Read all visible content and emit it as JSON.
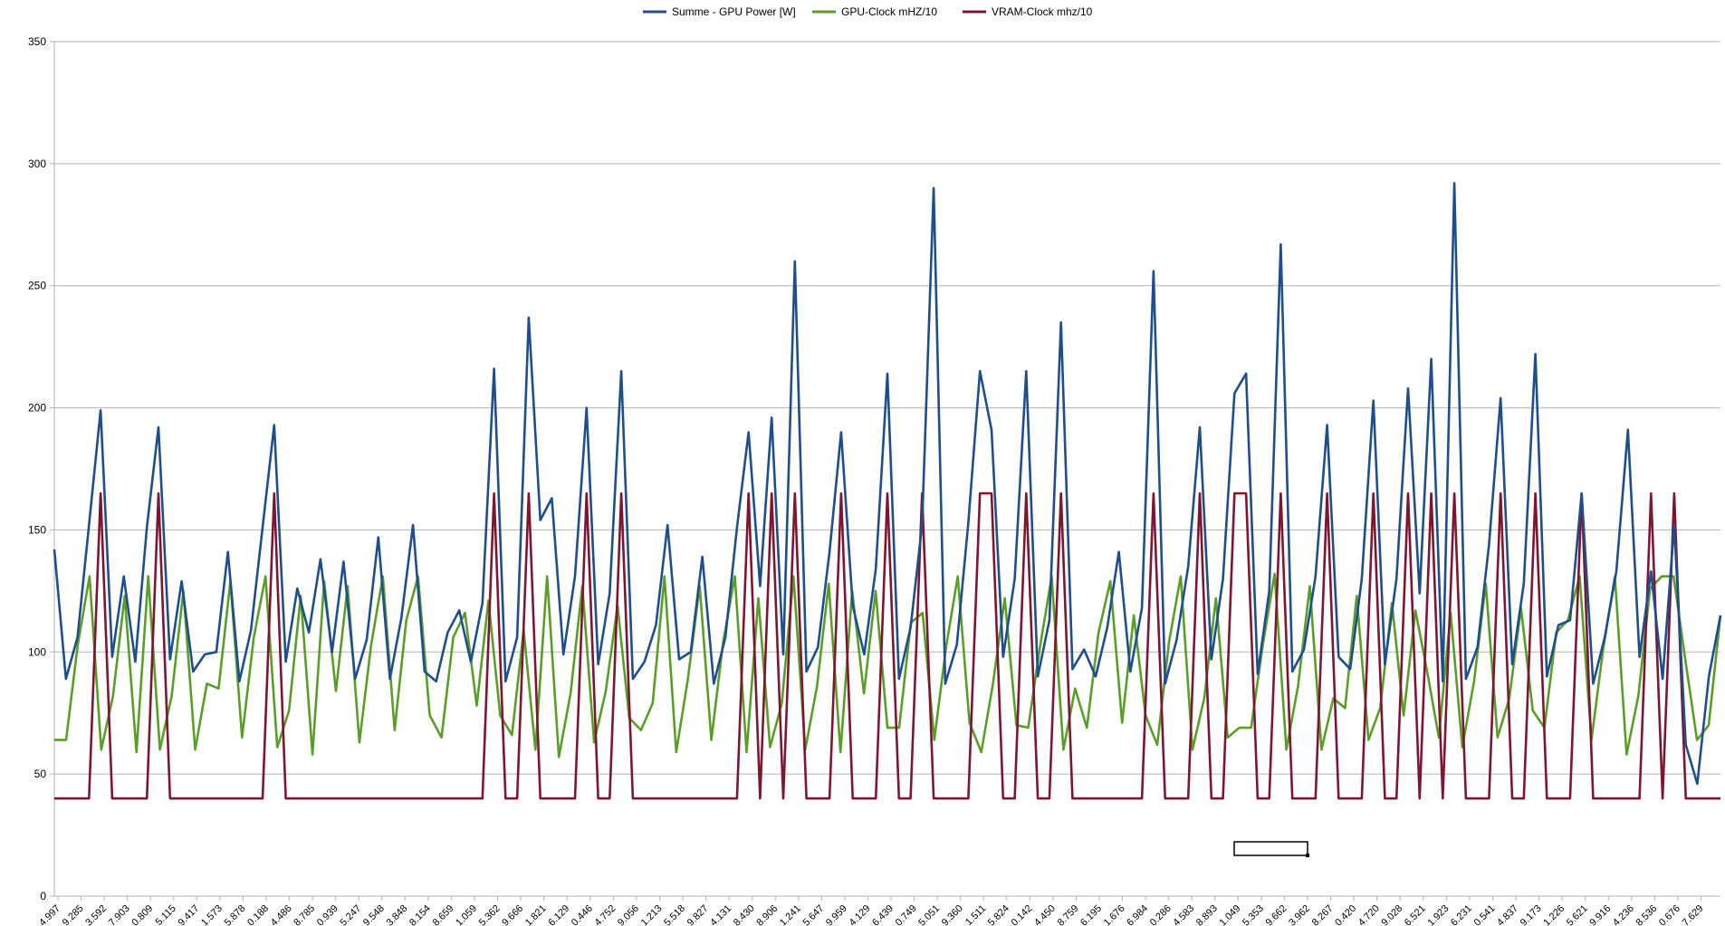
{
  "chart_data": {
    "type": "line",
    "title": "",
    "xlabel": "",
    "ylabel": "",
    "ylim": [
      0,
      350
    ],
    "yticks": [
      0,
      50,
      100,
      150,
      200,
      250,
      300,
      350
    ],
    "grid": "horizontal",
    "legend_position": "top-center",
    "colors": {
      "power": "#1f4e8c",
      "gpu_clock": "#5a9e28",
      "vram_clock": "#7e1632",
      "grid": "#b3b3b3",
      "axis": "#b3b3b3"
    },
    "x_tick_labels": [
      "4.997",
      "9.285",
      "3.592",
      "7.903",
      "0.809",
      "5.115",
      "9.417",
      "1.573",
      "5.878",
      "0.188",
      "4.486",
      "8.785",
      "0.939",
      "5.247",
      "9.548",
      "3.848",
      "8.154",
      "8.659",
      "1.059",
      "5.362",
      "9.666",
      "1.821",
      "6.129",
      "0.446",
      "4.752",
      "9.056",
      "1.213",
      "5.518",
      "9.827",
      "4.131",
      "8.430",
      "8.906",
      "1.241",
      "5.647",
      "9.959",
      "4.129",
      "6.439",
      "0.749",
      "5.051",
      "9.360",
      "1.511",
      "5.824",
      "0.142",
      "4.450",
      "8.759",
      "6.195",
      "1.676",
      "6.984",
      "0.286",
      "4.583",
      "8.893",
      "1.049",
      "5.353",
      "9.662",
      "3.962",
      "8.267",
      "0.420",
      "4.720",
      "9.028",
      "6.521",
      "1.923",
      "6.231",
      "0.541",
      "4.837",
      "9.173",
      "1.226",
      "5.621",
      "9.916",
      "4.236",
      "8.536",
      "0.676",
      "7.629"
    ],
    "series": [
      {
        "name": "Summe - GPU Power [W]",
        "values": [
          142,
          89,
          106,
          152,
          199,
          98,
          131,
          96,
          151,
          192,
          97,
          129,
          92,
          99,
          100,
          141,
          88,
          109,
          151,
          193,
          96,
          126,
          108,
          138,
          100,
          137,
          89,
          105,
          147,
          89,
          114,
          152,
          92,
          88,
          108,
          117,
          96,
          120,
          216,
          88,
          106,
          237,
          154,
          163,
          99,
          131,
          200,
          95,
          124,
          215,
          89,
          96,
          111,
          152,
          97,
          100,
          139,
          87,
          106,
          151,
          190,
          127,
          196,
          99,
          260,
          92,
          102,
          141,
          190,
          119,
          99,
          134,
          214,
          89,
          110,
          152,
          290,
          87,
          103,
          153,
          215,
          191,
          98,
          130,
          215,
          90,
          113,
          235,
          93,
          101,
          90,
          110,
          141,
          92,
          118,
          256,
          87,
          105,
          135,
          192,
          97,
          130,
          206,
          214,
          91,
          125,
          267,
          92,
          101,
          131,
          193,
          98,
          93,
          130,
          203,
          95,
          130,
          208,
          124,
          220,
          88,
          292,
          89,
          102,
          144,
          204,
          95,
          128,
          222,
          90,
          111,
          113,
          165,
          87,
          106,
          133,
          191,
          98,
          133,
          89,
          152,
          62,
          46,
          90,
          115
        ]
      },
      {
        "name": "GPU-Clock mHZ/10",
        "values": [
          64,
          64,
          103,
          131,
          60,
          82,
          123,
          59,
          131,
          60,
          82,
          125,
          60,
          87,
          85,
          129,
          65,
          106,
          131,
          61,
          76,
          123,
          58,
          129,
          84,
          127,
          63,
          103,
          131,
          68,
          113,
          131,
          74,
          65,
          106,
          116,
          78,
          121,
          74,
          66,
          109,
          60,
          131,
          57,
          83,
          127,
          63,
          84,
          119,
          73,
          68,
          79,
          131,
          59,
          89,
          127,
          64,
          104,
          131,
          59,
          122,
          61,
          79,
          131,
          60,
          86,
          128,
          59,
          125,
          83,
          125,
          69,
          69,
          112,
          116,
          64,
          102,
          131,
          71,
          59,
          87,
          122,
          70,
          69,
          102,
          131,
          60,
          85,
          69,
          108,
          129,
          71,
          115,
          74,
          62,
          104,
          131,
          60,
          81,
          122,
          65,
          69,
          69,
          103,
          132,
          60,
          86,
          127,
          60,
          81,
          77,
          123,
          64,
          77,
          120,
          74,
          117,
          92,
          65,
          116,
          61,
          88,
          128,
          65,
          81,
          118,
          76,
          69,
          108,
          113,
          131,
          64,
          101,
          131,
          58,
          82,
          126,
          131,
          131,
          97,
          64,
          70,
          115
        ]
      },
      {
        "name": "VRAM-Clock mhz/10",
        "values": [
          40,
          40,
          40,
          40,
          165,
          40,
          40,
          40,
          40,
          165,
          40,
          40,
          40,
          40,
          40,
          40,
          40,
          40,
          40,
          165,
          40,
          40,
          40,
          40,
          40,
          40,
          40,
          40,
          40,
          40,
          40,
          40,
          40,
          40,
          40,
          40,
          40,
          40,
          165,
          40,
          40,
          165,
          40,
          40,
          40,
          40,
          165,
          40,
          40,
          165,
          40,
          40,
          40,
          40,
          40,
          40,
          40,
          40,
          40,
          40,
          165,
          40,
          165,
          40,
          165,
          40,
          40,
          40,
          165,
          40,
          40,
          40,
          165,
          40,
          40,
          165,
          40,
          40,
          40,
          40,
          165,
          165,
          40,
          40,
          165,
          40,
          40,
          165,
          40,
          40,
          40,
          40,
          40,
          40,
          40,
          165,
          40,
          40,
          40,
          165,
          40,
          40,
          165,
          165,
          40,
          40,
          165,
          40,
          40,
          40,
          165,
          40,
          40,
          40,
          165,
          40,
          40,
          165,
          40,
          165,
          40,
          165,
          40,
          40,
          40,
          165,
          40,
          40,
          165,
          40,
          40,
          40,
          165,
          40,
          40,
          40,
          40,
          40,
          165,
          40,
          165,
          40,
          40,
          40,
          40
        ]
      }
    ]
  }
}
